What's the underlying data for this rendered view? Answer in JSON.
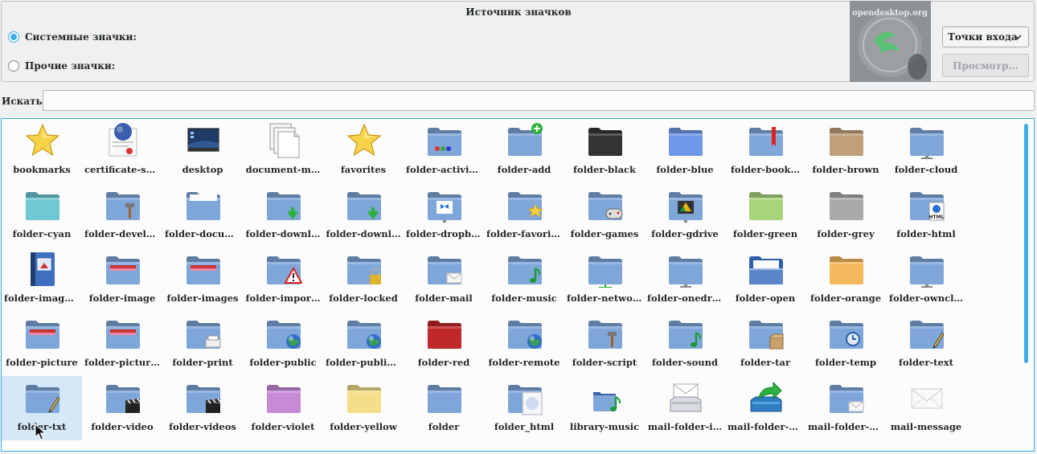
{
  "source_panel": {
    "title": "Источник значков",
    "system_label": "Системные значки:",
    "other_label": "Прочие значки:",
    "watermark": "opendesktop.org",
    "context_value": "Точки входа",
    "preview_button": "Просмотр..."
  },
  "search": {
    "label": "Искать:",
    "value": ""
  },
  "colors": {
    "accent": "#3daee9",
    "folder": "#7fa6d9"
  },
  "icons": [
    {
      "label": "bookmarks",
      "kind": "star"
    },
    {
      "label": "certificate-se…",
      "kind": "certificate"
    },
    {
      "label": "desktop",
      "kind": "desktop"
    },
    {
      "label": "document-m…",
      "kind": "documents"
    },
    {
      "label": "favorites",
      "kind": "star"
    },
    {
      "label": "folder-activities",
      "kind": "folder",
      "color": "#7fa6d9",
      "badge": "dots"
    },
    {
      "label": "folder-add",
      "kind": "folder",
      "color": "#7fa6d9",
      "badge": "plus"
    },
    {
      "label": "folder-black",
      "kind": "folder",
      "color": "#333333"
    },
    {
      "label": "folder-blue",
      "kind": "folder",
      "color": "#6f98e8"
    },
    {
      "label": "folder-book…",
      "kind": "folder",
      "color": "#7fa6d9",
      "badge": "bookmark"
    },
    {
      "label": "folder-brown",
      "kind": "folder",
      "color": "#bfa07a"
    },
    {
      "label": "folder-cloud",
      "kind": "folder",
      "color": "#7fa6d9",
      "badge": "stand"
    },
    {
      "label": "folder-cyan",
      "kind": "folder",
      "color": "#6fc8d3"
    },
    {
      "label": "folder-develo…",
      "kind": "folder",
      "color": "#7fa6d9",
      "badge": "hammer"
    },
    {
      "label": "folder-docum…",
      "kind": "folder",
      "color": "#7fa6d9",
      "badge": "paper"
    },
    {
      "label": "folder-downl…",
      "kind": "folder",
      "color": "#7fa6d9",
      "badge": "arrow"
    },
    {
      "label": "folder-downl…",
      "kind": "folder",
      "color": "#7fa6d9",
      "badge": "arrow"
    },
    {
      "label": "folder-dropbox",
      "kind": "folder",
      "color": "#7fa6d9",
      "badge": "dropbox"
    },
    {
      "label": "folder-favorites",
      "kind": "folder",
      "color": "#7fa6d9",
      "badge": "star"
    },
    {
      "label": "folder-games",
      "kind": "folder",
      "color": "#7fa6d9",
      "badge": "gamepad"
    },
    {
      "label": "folder-gdrive",
      "kind": "folder",
      "color": "#7fa6d9",
      "badge": "gdrive"
    },
    {
      "label": "folder-green",
      "kind": "folder",
      "color": "#a9d57a"
    },
    {
      "label": "folder-grey",
      "kind": "folder",
      "color": "#a9a9a9"
    },
    {
      "label": "folder-html",
      "kind": "folder",
      "color": "#7fa6d9",
      "badge": "html"
    },
    {
      "label": "folder-image-…",
      "kind": "book"
    },
    {
      "label": "folder-image",
      "kind": "folder",
      "color": "#7fa6d9",
      "badge": "image"
    },
    {
      "label": "folder-images",
      "kind": "folder",
      "color": "#7fa6d9",
      "badge": "image"
    },
    {
      "label": "folder-impor…",
      "kind": "folder",
      "color": "#7fa6d9",
      "badge": "warning"
    },
    {
      "label": "folder-locked",
      "kind": "folder",
      "color": "#7fa6d9",
      "badge": "lock"
    },
    {
      "label": "folder-mail",
      "kind": "folder",
      "color": "#7fa6d9",
      "badge": "mail"
    },
    {
      "label": "folder-music",
      "kind": "folder",
      "color": "#7fa6d9",
      "badge": "note"
    },
    {
      "label": "folder-network",
      "kind": "folder",
      "color": "#7fa6d9",
      "badge": "network"
    },
    {
      "label": "folder-onedrive",
      "kind": "folder",
      "color": "#7fa6d9",
      "badge": "stand"
    },
    {
      "label": "folder-open",
      "kind": "folder-open",
      "color": "#5a86c7"
    },
    {
      "label": "folder-orange",
      "kind": "folder",
      "color": "#f4b95c"
    },
    {
      "label": "folder-owncl…",
      "kind": "folder",
      "color": "#7fa6d9",
      "badge": "stand"
    },
    {
      "label": "folder-picture",
      "kind": "folder",
      "color": "#7fa6d9",
      "badge": "image"
    },
    {
      "label": "folder-pictures",
      "kind": "folder",
      "color": "#7fa6d9",
      "badge": "image"
    },
    {
      "label": "folder-print",
      "kind": "folder",
      "color": "#7fa6d9",
      "badge": "printer"
    },
    {
      "label": "folder-public",
      "kind": "folder",
      "color": "#7fa6d9",
      "badge": "globe"
    },
    {
      "label": "folder-public…",
      "kind": "folder",
      "color": "#7fa6d9",
      "badge": "globe"
    },
    {
      "label": "folder-red",
      "kind": "folder",
      "color": "#c0282a"
    },
    {
      "label": "folder-remote",
      "kind": "folder",
      "color": "#7fa6d9",
      "badge": "globe"
    },
    {
      "label": "folder-script",
      "kind": "folder",
      "color": "#7fa6d9",
      "badge": "hammer"
    },
    {
      "label": "folder-sound",
      "kind": "folder",
      "color": "#7fa6d9",
      "badge": "note"
    },
    {
      "label": "folder-tar",
      "kind": "folder",
      "color": "#7fa6d9",
      "badge": "box"
    },
    {
      "label": "folder-temp",
      "kind": "folder",
      "color": "#7fa6d9",
      "badge": "clock"
    },
    {
      "label": "folder-text",
      "kind": "folder",
      "color": "#7fa6d9",
      "badge": "pencil"
    },
    {
      "label": "folder-txt",
      "kind": "folder",
      "color": "#7fa6d9",
      "badge": "pencil",
      "selected": true
    },
    {
      "label": "folder-video",
      "kind": "folder",
      "color": "#7fa6d9",
      "badge": "clapper"
    },
    {
      "label": "folder-videos",
      "kind": "folder",
      "color": "#7fa6d9",
      "badge": "clapper"
    },
    {
      "label": "folder-violet",
      "kind": "folder",
      "color": "#c78bd6"
    },
    {
      "label": "folder-yellow",
      "kind": "folder",
      "color": "#f3de8a"
    },
    {
      "label": "folder",
      "kind": "folder",
      "color": "#7fa6d9"
    },
    {
      "label": "folder_html",
      "kind": "folder",
      "color": "#7fa6d9",
      "badge": "html-page"
    },
    {
      "label": "library-music",
      "kind": "folder-small",
      "color": "#7fa6d9",
      "badge": "note"
    },
    {
      "label": "mail-folder-i…",
      "kind": "tray-in"
    },
    {
      "label": "mail-folder-o…",
      "kind": "tray-out"
    },
    {
      "label": "mail-folder-s…",
      "kind": "folder",
      "color": "#7fa6d9",
      "badge": "mail"
    },
    {
      "label": "mail-message",
      "kind": "envelope"
    }
  ]
}
